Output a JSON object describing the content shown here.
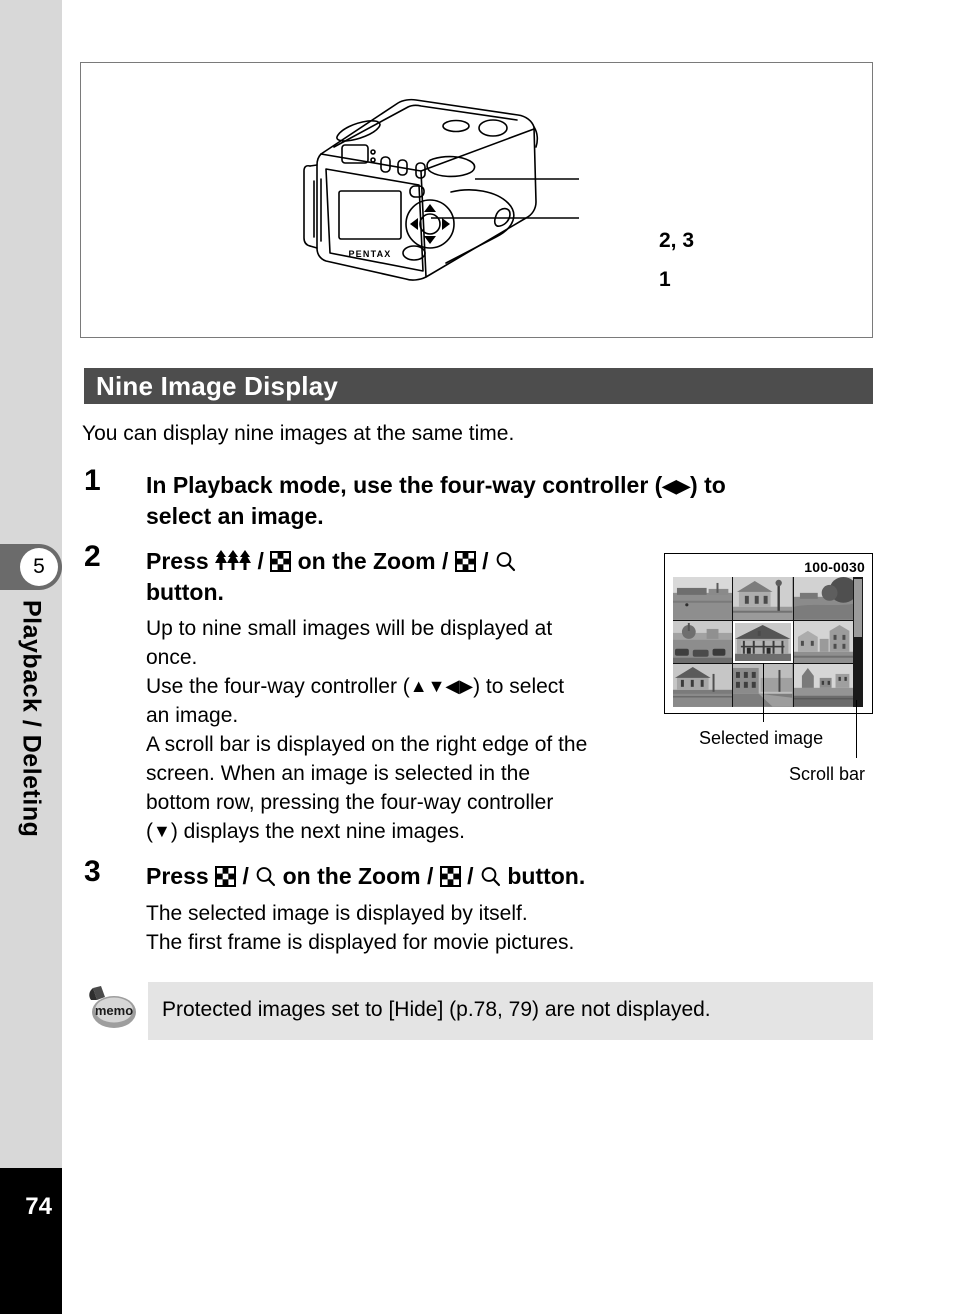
{
  "sidebar": {
    "chapter_number": "5",
    "chapter_label": "Playback / Deleting",
    "page_number": "74"
  },
  "illustration": {
    "alt": "pentax-digital-camera-rear-view",
    "brand_text": "PENTAX",
    "callouts": [
      {
        "id": "zoom-button",
        "label": "2, 3"
      },
      {
        "id": "four-way-controller",
        "label": "1"
      }
    ]
  },
  "section": {
    "title": "Nine Image Display",
    "intro": "You can display nine images at the same time."
  },
  "steps": [
    {
      "number": "1",
      "heading_parts": [
        "In Playback mode, use the four-way controller (",
        "◀",
        "▶",
        ") to select an image."
      ],
      "body": []
    },
    {
      "number": "2",
      "heading_parts": [
        "Press ",
        "wide-trees-icon",
        " / ",
        "nine-image-grid-icon",
        " on the Zoom / ",
        "nine-image-grid-icon",
        " / ",
        "magnifier-icon",
        " button."
      ],
      "body": [
        "Up to nine small images will be displayed at once.",
        "Use the four-way controller (▲▼◀▶) to select an image.",
        "A scroll bar is displayed on the right edge of the screen. When an image is selected in the bottom row, pressing the four-way controller (▼) displays the next nine images."
      ]
    },
    {
      "number": "3",
      "heading_parts": [
        "Press ",
        "nine-image-grid-icon",
        " / ",
        "magnifier-icon",
        " on the Zoom / ",
        "nine-image-grid-icon",
        " / ",
        "magnifier-icon",
        " button."
      ],
      "body": [
        "The selected image is displayed by itself.",
        "The first frame is displayed for movie pictures."
      ]
    }
  ],
  "step_body_text": {
    "s2_line1": "Up to nine small images will be displayed at",
    "s2_line2": "once.",
    "s2_line3a": "Use the four-way controller (",
    "s2_line3b": ") to select",
    "s2_line4": "an image.",
    "s2_line5": "A scroll bar is displayed on the right edge of the",
    "s2_line6": "screen. When an image is selected in the",
    "s2_line7": "bottom row, pressing the four-way controller",
    "s2_line8a": "(",
    "s2_line8b": ") displays the next nine images.",
    "s3_line1": "The selected image is displayed by itself.",
    "s3_line2": "The first frame is displayed for movie pictures."
  },
  "step_heading_text": {
    "s1_a": "In Playback mode, use the four-way controller (",
    "s1_b": ") to",
    "s1_c": "select an image.",
    "s2_a": "Press ",
    "s2_b": " / ",
    "s2_c": " on the Zoom / ",
    "s2_d": " / ",
    "s2_e": "button.",
    "s3_a": "Press ",
    "s3_b": " / ",
    "s3_c": " on the Zoom / ",
    "s3_d": " / ",
    "s3_e": " button."
  },
  "figure": {
    "file_number": "100-0030",
    "annotation_selected": "Selected image",
    "annotation_scrollbar": "Scroll bar",
    "thumbnails": [
      {
        "id": "thumb-1",
        "caption": "park-with-building",
        "selected": false
      },
      {
        "id": "thumb-2",
        "caption": "town-house-with-lamppost",
        "selected": false
      },
      {
        "id": "thumb-3",
        "caption": "park-with-trees",
        "selected": false
      },
      {
        "id": "thumb-4",
        "caption": "harbor-with-cars",
        "selected": false
      },
      {
        "id": "thumb-5",
        "caption": "half-timbered-house",
        "selected": true
      },
      {
        "id": "thumb-6",
        "caption": "street-with-buildings",
        "selected": false
      },
      {
        "id": "thumb-7",
        "caption": "house-by-canal",
        "selected": false
      },
      {
        "id": "thumb-8",
        "caption": "canal-with-warehouse",
        "selected": false
      },
      {
        "id": "thumb-9",
        "caption": "harbor-town-view",
        "selected": false
      }
    ],
    "scrollbar": {
      "position_percent": 12
    }
  },
  "memo": {
    "icon_label": "memo",
    "text": "Protected images set to [Hide] (p.78, 79) are not displayed."
  },
  "colors": {
    "header_bar": "#4d4d4d",
    "rail": "#d8d8d8",
    "chapter_tab": "#6b6b6b",
    "memo_background": "#e4e4e4",
    "page_block": "#000000"
  }
}
